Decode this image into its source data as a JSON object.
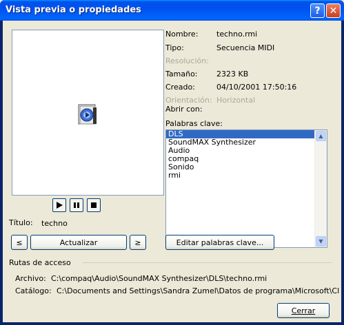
{
  "window": {
    "title": "Vista previa o propiedades",
    "help_glyph": "?",
    "close_glyph": "✕"
  },
  "props": {
    "nombre_label": "Nombre:",
    "nombre_value": "techno.rmi",
    "tipo_label": "Tipo:",
    "tipo_value": "Secuencia MIDI",
    "resolucion_label": "Resolución:",
    "tamano_label": "Tamaño:",
    "tamano_value": "2323 KB",
    "creado_label": "Creado:",
    "creado_value": "04/10/2001 17:50:16",
    "orientacion_label": "Orientación:",
    "orientacion_value": "Horizontal",
    "abrir_label": "Abrir con:"
  },
  "keywords": {
    "label": "Palabras clave:",
    "items": [
      "DLS",
      "SoundMAX Synthesizer",
      "Audio",
      "compaq",
      "Sonido",
      "rmi"
    ],
    "selected_index": 0,
    "edit_button": "Editar palabras clave..."
  },
  "player": {
    "title_label": "Título:",
    "title_value": "techno"
  },
  "nav": {
    "prev": "≤",
    "refresh": "Actualizar",
    "next": "≥"
  },
  "paths": {
    "group_label": "Rutas de acceso",
    "archivo_label": "Archivo:",
    "archivo_value": "C:\\compaq\\Audio\\SoundMAX Synthesizer\\DLS\\techno.rmi",
    "catalogo_label": "Catálogo:",
    "catalogo_value": "C:\\Documents and Settings\\Sandra Zumel\\Datos de programa\\Microsoft\\Clip C"
  },
  "footer": {
    "close_button": "Cerrar"
  },
  "colors": {
    "titlebar": "#0054e3",
    "selection": "#316ac5",
    "dialog_bg": "#ece9d8"
  }
}
